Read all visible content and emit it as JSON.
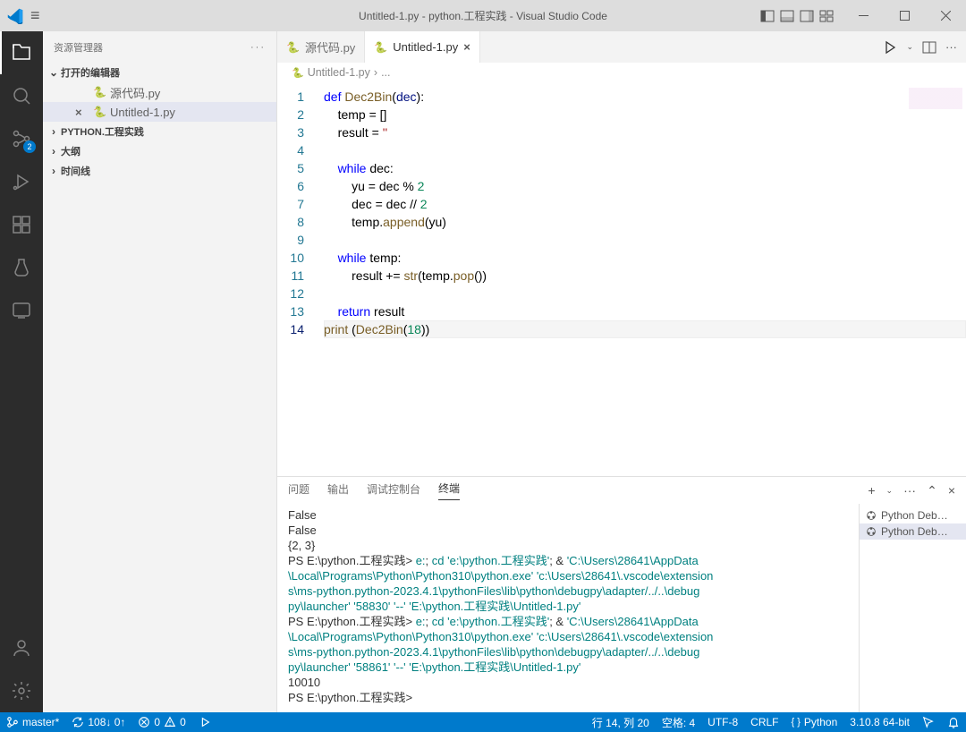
{
  "titlebar": {
    "title": "Untitled-1.py - python.工程实践 - Visual Studio Code"
  },
  "activitybar": {
    "badge_scm": "2"
  },
  "sidebar": {
    "title": "资源管理器",
    "sections": {
      "open_editors": "打开的编辑器",
      "project": "PYTHON.工程实践",
      "outline": "大纲",
      "timeline": "时间线"
    },
    "open_items": [
      {
        "name": "源代码.py"
      },
      {
        "name": "Untitled-1.py"
      }
    ]
  },
  "tabs": [
    {
      "label": "源代码.py"
    },
    {
      "label": "Untitled-1.py"
    }
  ],
  "breadcrumb": {
    "file": "Untitled-1.py",
    "sep": "›",
    "rest": "..."
  },
  "code": {
    "lines": [
      {
        "n": "1",
        "tokens": [
          {
            "t": "def ",
            "c": "kw"
          },
          {
            "t": "Dec2Bin",
            "c": "fn"
          },
          {
            "t": "(",
            "c": "op"
          },
          {
            "t": "dec",
            "c": "prm"
          },
          {
            "t": "):",
            "c": "op"
          }
        ]
      },
      {
        "n": "2",
        "indent": 1,
        "tokens": [
          {
            "t": "temp = []",
            "c": "op"
          }
        ]
      },
      {
        "n": "3",
        "indent": 1,
        "tokens": [
          {
            "t": "result = ",
            "c": "op"
          },
          {
            "t": "''",
            "c": "str"
          }
        ]
      },
      {
        "n": "4",
        "indent": 0,
        "tokens": []
      },
      {
        "n": "5",
        "indent": 1,
        "tokens": [
          {
            "t": "while ",
            "c": "kw"
          },
          {
            "t": "dec:",
            "c": "op"
          }
        ]
      },
      {
        "n": "6",
        "indent": 2,
        "tokens": [
          {
            "t": "yu = dec % ",
            "c": "op"
          },
          {
            "t": "2",
            "c": "num"
          }
        ]
      },
      {
        "n": "7",
        "indent": 2,
        "tokens": [
          {
            "t": "dec = dec // ",
            "c": "op"
          },
          {
            "t": "2",
            "c": "num"
          }
        ]
      },
      {
        "n": "8",
        "indent": 2,
        "tokens": [
          {
            "t": "temp.",
            "c": "op"
          },
          {
            "t": "append",
            "c": "fn"
          },
          {
            "t": "(yu)",
            "c": "op"
          }
        ]
      },
      {
        "n": "9",
        "indent": 0,
        "tokens": []
      },
      {
        "n": "10",
        "indent": 1,
        "tokens": [
          {
            "t": "while ",
            "c": "kw"
          },
          {
            "t": "temp:",
            "c": "op"
          }
        ]
      },
      {
        "n": "11",
        "indent": 2,
        "tokens": [
          {
            "t": "result += ",
            "c": "op"
          },
          {
            "t": "str",
            "c": "fn"
          },
          {
            "t": "(temp.",
            "c": "op"
          },
          {
            "t": "pop",
            "c": "fn"
          },
          {
            "t": "())",
            "c": "op"
          }
        ]
      },
      {
        "n": "12",
        "indent": 0,
        "tokens": []
      },
      {
        "n": "13",
        "indent": 1,
        "tokens": [
          {
            "t": "return ",
            "c": "kw"
          },
          {
            "t": "result",
            "c": "op"
          }
        ]
      },
      {
        "n": "14",
        "indent": 0,
        "cur": true,
        "tokens": [
          {
            "t": "print",
            "c": "fn"
          },
          {
            "t": " (",
            "c": "op"
          },
          {
            "t": "Dec2Bin",
            "c": "fn"
          },
          {
            "t": "(",
            "c": "op"
          },
          {
            "t": "18",
            "c": "num"
          },
          {
            "t": "))",
            "c": "op"
          }
        ]
      }
    ]
  },
  "panel": {
    "tabs": {
      "problems": "问题",
      "output": "输出",
      "debug": "调试控制台",
      "terminal": "终端"
    },
    "side_items": [
      "Python Deb…",
      "Python Deb…"
    ],
    "terminal_lines": [
      {
        "segs": [
          {
            "t": "False"
          }
        ]
      },
      {
        "segs": [
          {
            "t": "False"
          }
        ]
      },
      {
        "segs": [
          {
            "t": "{2, 3}"
          }
        ]
      },
      {
        "segs": [
          {
            "t": "PS E:\\python.工程实践> ",
            "c": "prompt"
          },
          {
            "t": "e:",
            "c": "teal"
          },
          {
            "t": "; "
          },
          {
            "t": "cd 'e:\\python.工程实践'",
            "c": "teal"
          },
          {
            "t": "; & "
          },
          {
            "t": "'C:\\Users\\28641\\AppData",
            "c": "teal"
          }
        ]
      },
      {
        "segs": [
          {
            "t": "\\Local\\Programs\\Python\\Python310\\python.exe' 'c:\\Users\\28641\\.vscode\\extension",
            "c": "teal"
          }
        ]
      },
      {
        "segs": [
          {
            "t": "s\\ms-python.python-2023.4.1\\pythonFiles\\lib\\python\\debugpy\\adapter/../..\\debug",
            "c": "teal"
          }
        ]
      },
      {
        "segs": [
          {
            "t": "py\\launcher' '58830' '--' 'E:\\python.工程实践\\Untitled-1.py'",
            "c": "teal"
          }
        ]
      },
      {
        "segs": [
          {
            "t": "PS E:\\python.工程实践> ",
            "c": "prompt"
          },
          {
            "t": "e:",
            "c": "teal"
          },
          {
            "t": "; "
          },
          {
            "t": "cd 'e:\\python.工程实践'",
            "c": "teal"
          },
          {
            "t": "; & "
          },
          {
            "t": "'C:\\Users\\28641\\AppData",
            "c": "teal"
          }
        ]
      },
      {
        "segs": [
          {
            "t": "\\Local\\Programs\\Python\\Python310\\python.exe' 'c:\\Users\\28641\\.vscode\\extension",
            "c": "teal"
          }
        ]
      },
      {
        "segs": [
          {
            "t": "s\\ms-python.python-2023.4.1\\pythonFiles\\lib\\python\\debugpy\\adapter/../..\\debug",
            "c": "teal"
          }
        ]
      },
      {
        "segs": [
          {
            "t": "py\\launcher' '58861' '--' 'E:\\python.工程实践\\Untitled-1.py'",
            "c": "teal"
          }
        ]
      },
      {
        "segs": [
          {
            "t": "10010"
          }
        ]
      },
      {
        "segs": [
          {
            "t": "PS E:\\python.工程实践>",
            "c": "prompt"
          }
        ]
      }
    ]
  },
  "statusbar": {
    "branch": "master*",
    "sync": "108↓ 0↑",
    "errors": "0",
    "warnings": "0",
    "cursor": "行 14, 列 20",
    "spaces": "空格: 4",
    "encoding": "UTF-8",
    "eol": "CRLF",
    "lang": "Python",
    "version": "3.10.8 64-bit"
  }
}
